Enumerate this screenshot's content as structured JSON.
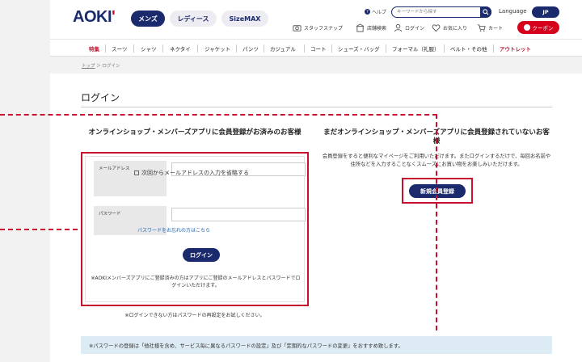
{
  "brand": {
    "logo": "AOKI",
    "logo_mark": "'"
  },
  "categories": [
    {
      "label": "メンズ",
      "active": true
    },
    {
      "label": "レディース",
      "active": false
    },
    {
      "label": "SizeMAX",
      "active": false
    }
  ],
  "header": {
    "help": "ヘルプ",
    "search_placeholder": "キーワードから探す",
    "language_label": "Language",
    "language_value": "JP",
    "util": {
      "staff_snap": "スタッフスナップ",
      "store_search": "店舗検索",
      "login": "ログイン",
      "favorites": "お気に入り",
      "cart": "カート"
    },
    "coupon": "クーポン"
  },
  "nav": [
    "特集",
    "スーツ",
    "シャツ",
    "ネクタイ",
    "ジャケット",
    "パンツ",
    "カジュアル",
    "コート",
    "シューズ・バッグ",
    "フォーマル（礼服）",
    "ベルト・その他",
    "アウトレット"
  ],
  "breadcrumb": {
    "home": "トップ",
    "separator": "＞",
    "current": "ログイン"
  },
  "page": {
    "title": "ログイン",
    "left_heading": "オンラインショップ・メンバーズアプリに会員登録がお済みのお客様",
    "email_label": "メールアドレス",
    "remember_label": "次回からメールアドレスの入力を省略する",
    "password_label": "パスワード",
    "forgot_link": "パスワードをお忘れの方はこちら",
    "login_button": "ログイン",
    "app_note": "※AOKIメンバーズアプリにご登録済みの方はアプリにご登録のメールアドレスとパスワードでログインいただけます。",
    "below_note": "※ログインできない方はパスワードの再設定をお試しください。",
    "right_heading": "まだオンラインショップ・メンバーズアプリに会員登録されていないお客様",
    "right_desc": "会員登録をすると便利なマイページをご利用いただけます。またログインするだけで、毎回お名前や住所などを入力することなくスムーズにお買い物をお楽しみいただけます。",
    "register_button": "新規会員登録",
    "password_info": "※パスワードの登録は「他社様を含め、サービス毎に異なるパスワードの設定」及び「定期的なパスワードの変更」をおすすめ致します。"
  },
  "colors": {
    "navy": "#1a2a6c",
    "accent_red": "#c8102e",
    "coupon_red": "#d7001c",
    "info_bg": "#dcebf4"
  }
}
